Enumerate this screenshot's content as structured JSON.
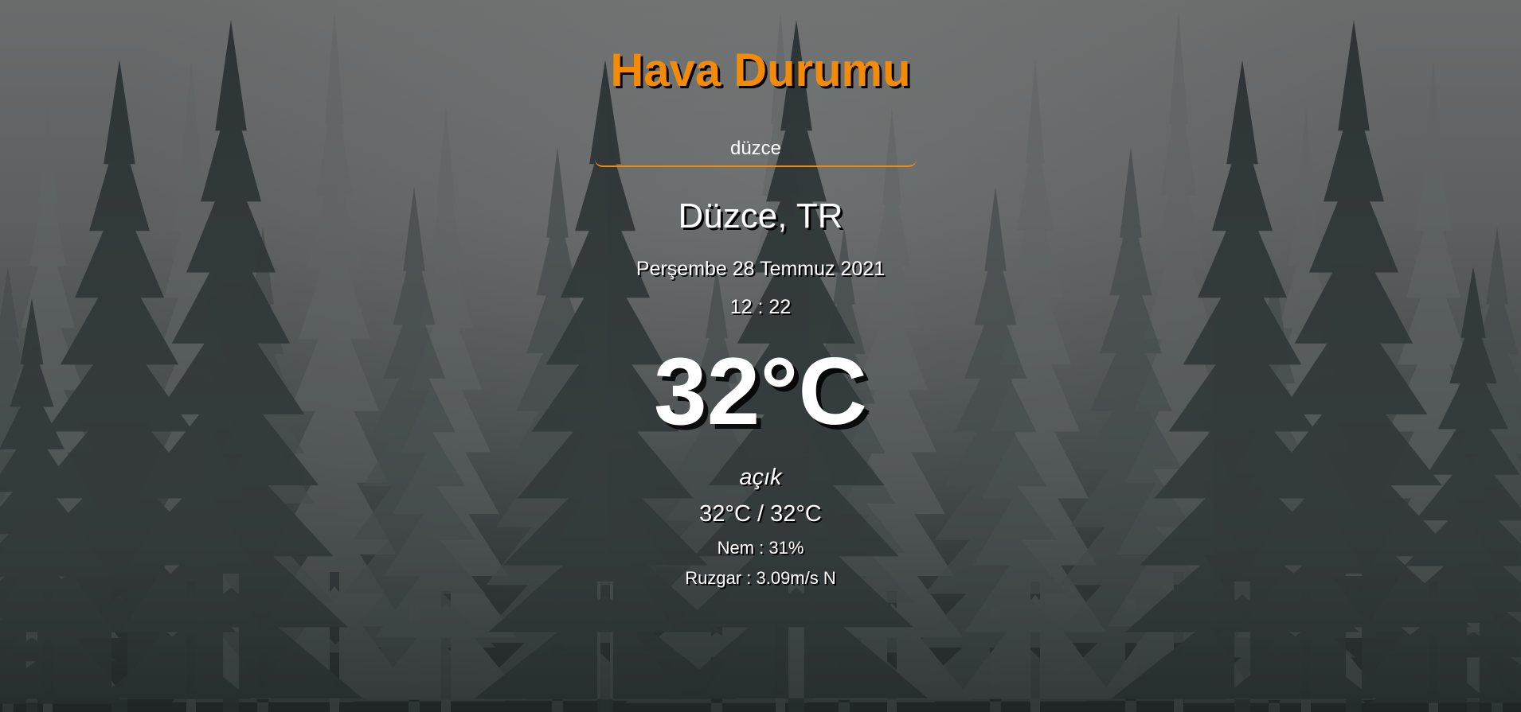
{
  "app": {
    "title": "Hava Durumu",
    "accent_color": "#f58a05",
    "background": "foggy-pine-forest"
  },
  "search": {
    "value": "düzce",
    "placeholder": ""
  },
  "weather": {
    "location": "Düzce, TR",
    "date": "Perşembe 28 Temmuz 2021",
    "time": "12 : 22",
    "temperature": "32°C",
    "condition": "açık",
    "hi_lo": "32°C / 32°C",
    "humidity": "Nem : 31%",
    "wind": "Ruzgar : 3.09m/s N"
  }
}
